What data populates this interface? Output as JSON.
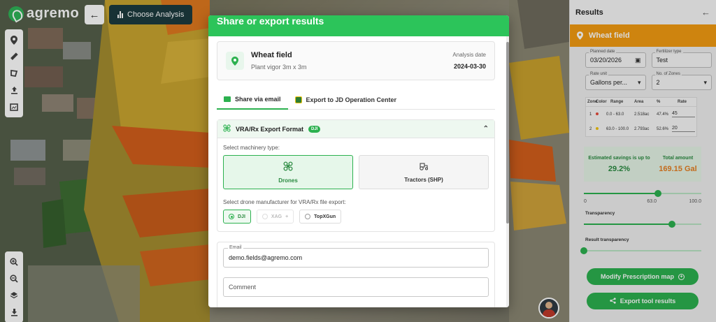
{
  "app": {
    "logo_text": "agremo",
    "choose_analysis_label": "Choose Analysis"
  },
  "modal": {
    "title": "Share or export results",
    "field": {
      "name": "Wheat field",
      "subtitle": "Plant vigor 3m x 3m",
      "date_label": "Analysis date",
      "date_value": "2024-03-30"
    },
    "tabs": [
      {
        "label": "Share via email",
        "active": true,
        "icon": "mail-icon"
      },
      {
        "label": "Export to JD Operation Center",
        "active": false,
        "icon": "john-deere-icon"
      }
    ],
    "export": {
      "title": "VRA/Rx Export Format",
      "badge": "DJI",
      "machinery_label": "Select machinery type:",
      "machines": [
        {
          "label": "Drones",
          "selected": true,
          "icon": "drone-icon"
        },
        {
          "label": "Tractors (SHP)",
          "selected": false,
          "icon": "tractor-icon"
        }
      ],
      "manufacturer_label": "Select drone manufacturer for VRA/Rx file export:",
      "manufacturers": [
        {
          "label": "DJI",
          "selected": true,
          "disabled": false
        },
        {
          "label": "XAG",
          "selected": false,
          "disabled": true
        },
        {
          "label": "TopXGun",
          "selected": false,
          "disabled": false
        }
      ]
    },
    "email": {
      "label": "Email",
      "value": "demo.fields@agremo.com",
      "comment_placeholder": "Comment"
    }
  },
  "panel": {
    "title": "Results",
    "field_name": "Wheat field",
    "planned_date_label": "Planned date",
    "planned_date_value": "03/20/2026",
    "fertilizer_label": "Fertilizer type",
    "fertilizer_value": "Test",
    "rate_unit_label": "Rate unit",
    "rate_unit_value": "Gallons per...",
    "zones_label": "No. of Zones",
    "zones_value": "2",
    "table_headers": [
      "Zone",
      "Color",
      "Range",
      "Area",
      "%",
      "Rate"
    ],
    "zones": [
      {
        "zone": "1",
        "color": "#e74c3c",
        "range": "0.0 - 63.0",
        "area": "2.518ac",
        "pct": "47.4%",
        "rate": "45"
      },
      {
        "zone": "2",
        "color": "#f1c40f",
        "range": "63.0 - 100.0",
        "area": "2.793ac",
        "pct": "52.6%",
        "rate": "20"
      }
    ],
    "savings_label": "Estimated savings is up to",
    "savings_value": "29.2%",
    "total_label": "Total amount",
    "total_value": "169.15 Gal",
    "range_slider": {
      "min": "0",
      "mid": "63.0",
      "max": "100.0",
      "value": 63
    },
    "transparency_label": "Transparency",
    "transparency_value": 75,
    "result_transparency_label": "Result transparency",
    "result_transparency_value": 0,
    "modify_button": "Modify Prescription map",
    "export_button": "Export tool results",
    "colors": {
      "accent": "#2cb14f",
      "field_bar": "#f39c12",
      "savings": "#2a8a40",
      "total": "#e67e22"
    }
  }
}
